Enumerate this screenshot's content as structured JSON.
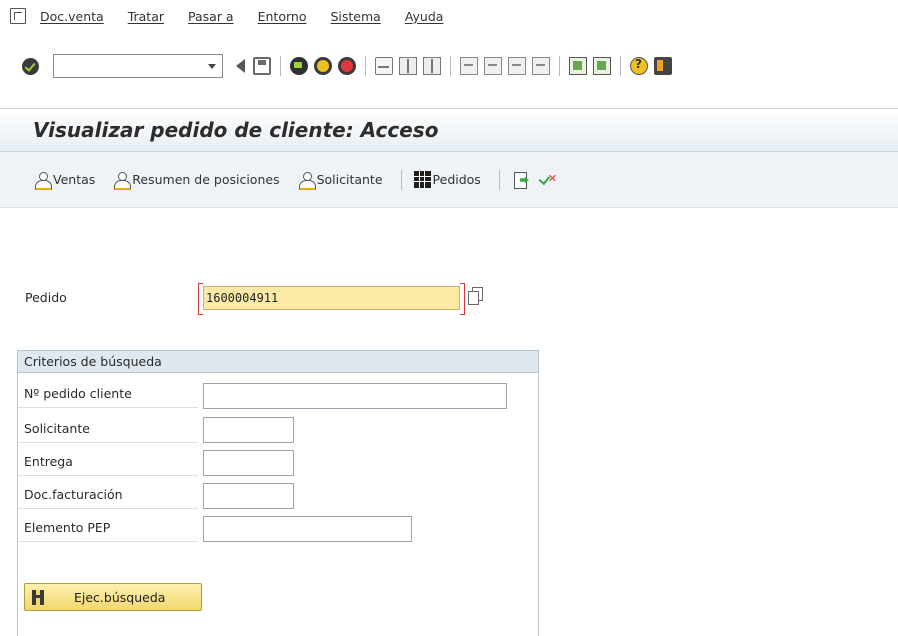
{
  "menubar": {
    "items": [
      "Doc.venta",
      "Tratar",
      "Pasar a",
      "Entorno",
      "Sistema",
      "Ayuda"
    ]
  },
  "toolbar": {
    "command_value": "",
    "icons": [
      "back-icon",
      "save-icon",
      "green-back-icon",
      "exit-icon",
      "cancel-icon",
      "print-icon",
      "find-icon",
      "find-next-icon",
      "first-page-icon",
      "previous-page-icon",
      "next-page-icon",
      "last-page-icon",
      "new-session-icon",
      "shortcut-icon",
      "help-icon",
      "customize-layout-icon"
    ]
  },
  "title": "Visualizar pedido de cliente: Acceso",
  "app_toolbar": {
    "ventas": "Ventas",
    "resumen": "Resumen de posiciones",
    "solicitante": "Solicitante",
    "pedidos": "Pedidos"
  },
  "pedido": {
    "label": "Pedido",
    "value": "1600004911"
  },
  "criterios": {
    "title": "Criterios de búsqueda",
    "rows": [
      {
        "label": "Nº pedido cliente",
        "value": ""
      },
      {
        "label": "Solicitante",
        "value": ""
      },
      {
        "label": "Entrega",
        "value": ""
      },
      {
        "label": "Doc.facturación",
        "value": ""
      },
      {
        "label": "Elemento PEP",
        "value": ""
      }
    ],
    "search_button": "Ejec.búsqueda"
  },
  "colors": {
    "title_bar": "#e6edf3",
    "app_toolbar": "#eef3f7",
    "required_field": "#fde9a6",
    "button": "#f3d86c"
  }
}
